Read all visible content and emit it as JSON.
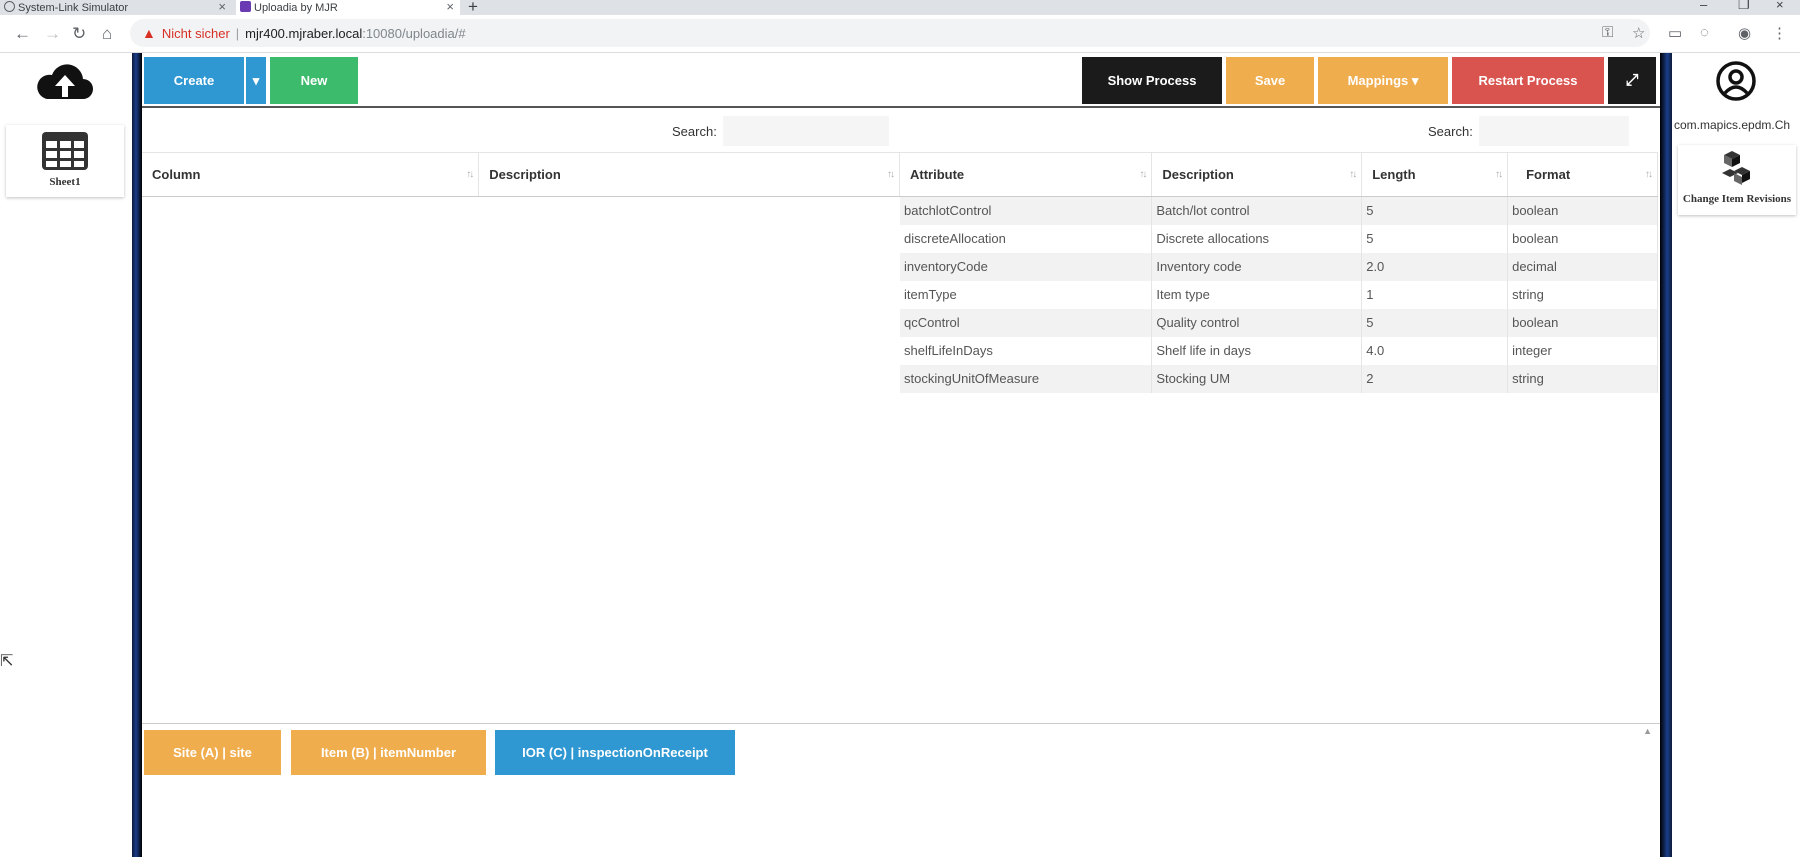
{
  "browser": {
    "tabs": [
      {
        "title": "System-Link Simulator"
      },
      {
        "title": "Uploadia by MJR"
      }
    ],
    "address": {
      "security_text": "Nicht sicher",
      "host": "mjr400.mjraber.local",
      "path": ":10080/uploadia/#"
    }
  },
  "sidebar": {
    "sheet_label": "Sheet1"
  },
  "toolbar": {
    "create": "Create",
    "new": "New",
    "show_process": "Show Process",
    "save": "Save",
    "mappings": "Mappings ▾",
    "restart": "Restart Process"
  },
  "left_table": {
    "search_label": "Search:",
    "columns": [
      "Column",
      "Description"
    ]
  },
  "right_table": {
    "search_label": "Search:",
    "columns": [
      "Attribute",
      "Description",
      "Length",
      "Format"
    ],
    "rows": [
      [
        "batchlotControl",
        "Batch/lot control",
        "5",
        "boolean"
      ],
      [
        "discreteAllocation",
        "Discrete allocations",
        "5",
        "boolean"
      ],
      [
        "inventoryCode",
        "Inventory code",
        "2.0",
        "decimal"
      ],
      [
        "itemType",
        "Item type",
        "1",
        "string"
      ],
      [
        "qcControl",
        "Quality control",
        "5",
        "boolean"
      ],
      [
        "shelfLifeInDays",
        "Shelf life in days",
        "4.0",
        "integer"
      ],
      [
        "stockingUnitOfMeasure",
        "Stocking UM",
        "2",
        "string"
      ]
    ]
  },
  "mappings": [
    {
      "label": "Site (A) | site",
      "color": "#f0ad4e"
    },
    {
      "label": "Item (B) | itemNumber",
      "color": "#f0ad4e"
    },
    {
      "label": "IOR (C) | inspectionOnReceipt",
      "color": "#2f97d1"
    }
  ],
  "right_sidebar": {
    "package": "com.mapics.epdm.Ch",
    "action_label": "Change Item Revisions"
  },
  "colors": {
    "create": "#2f97d1",
    "new": "#3dbb6c",
    "save": "#f0ad4e",
    "restart": "#d9534f",
    "show_process": "#1b1b1b"
  }
}
